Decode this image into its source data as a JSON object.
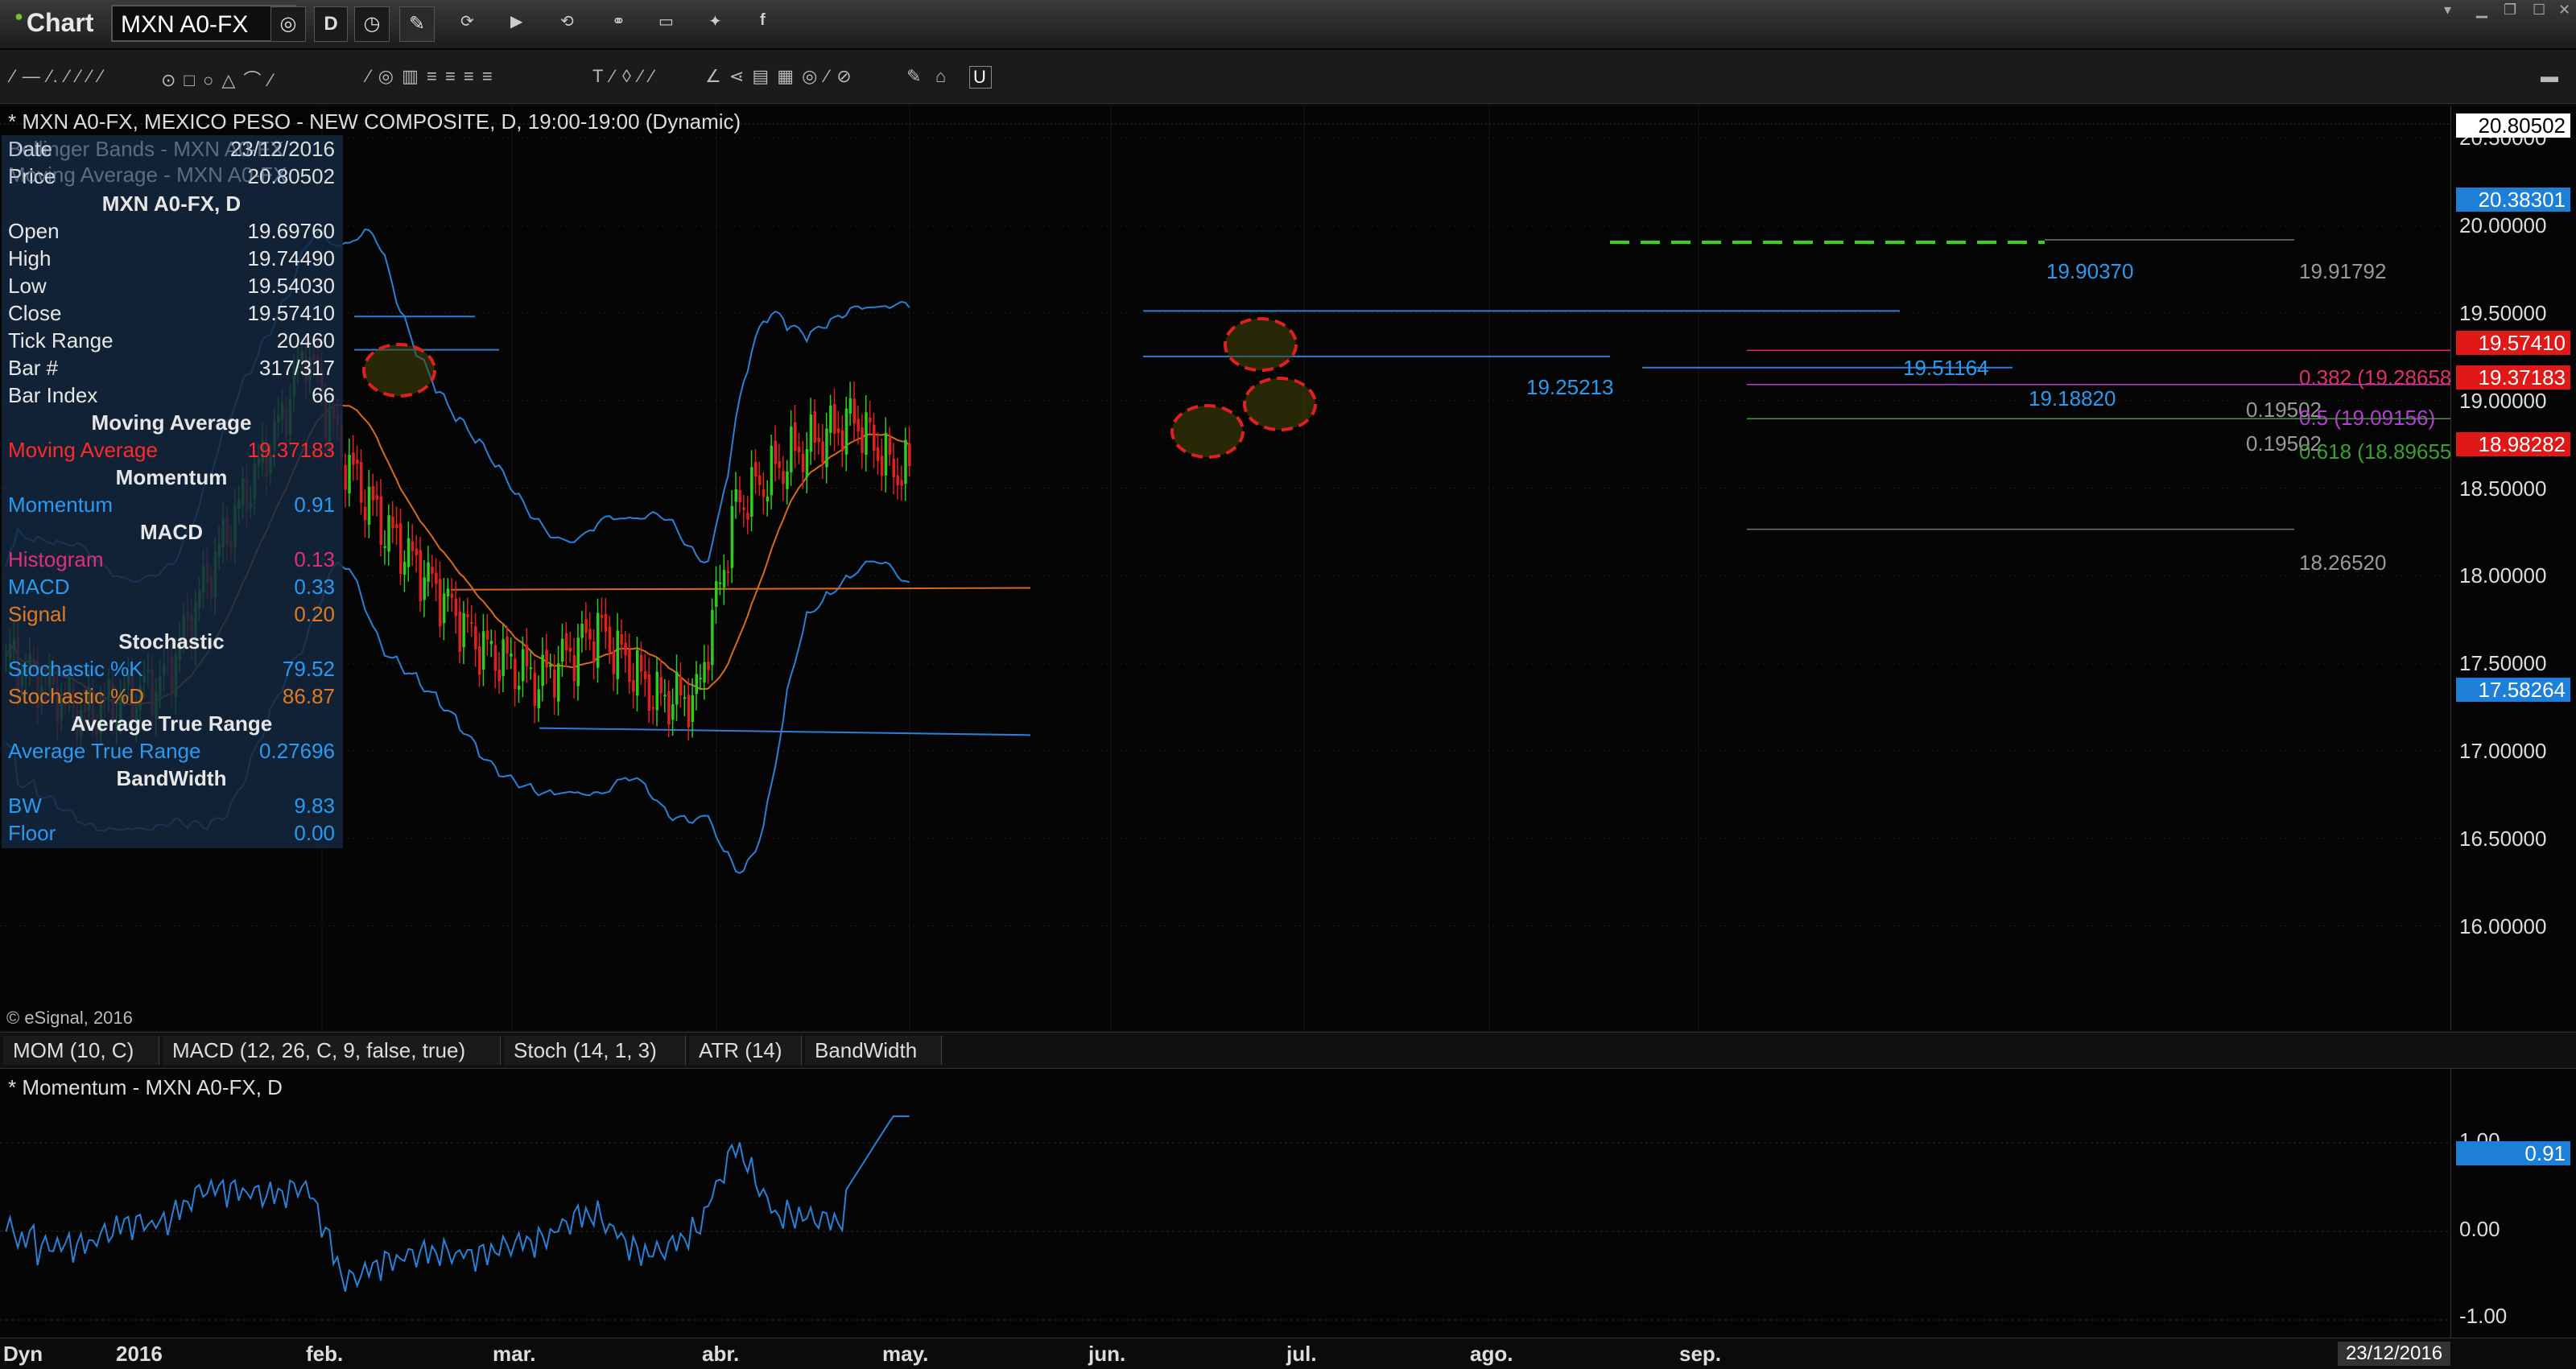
{
  "app": {
    "title": "Chart",
    "symbol": "MXN A0-FX",
    "interval": "D"
  },
  "chart": {
    "title": "* MXN A0-FX, MEXICO PESO - NEW COMPOSITE, D, 19:00-19:00 (Dynamic)",
    "legend_bb": "Bollinger Bands - MXN A0-FX",
    "legend_ma": "Moving Average - MXN A0-FX",
    "copyright": "© eSignal, 2016"
  },
  "info_panel": {
    "date_k": "Date",
    "date_v": "23/12/2016",
    "price_k": "Price",
    "price_v": "20.80502",
    "section": "MXN A0-FX, D",
    "open_k": "Open",
    "open_v": "19.69760",
    "high_k": "High",
    "high_v": "19.74490",
    "low_k": "Low",
    "low_v": "19.54030",
    "close_k": "Close",
    "close_v": "19.57410",
    "tick_k": "Tick Range",
    "tick_v": "20460",
    "bar_k": "Bar #",
    "bar_v": "317/317",
    "bar_index_k": "Bar Index",
    "bar_index_v": "66",
    "ma_hdr": "Moving Average",
    "ma_k": "Moving Average",
    "ma_v": "19.37183",
    "mom_hdr": "Momentum",
    "mom_k": "Momentum",
    "mom_v": "0.91",
    "macd_hdr": "MACD",
    "hist_k": "Histogram",
    "hist_v": "0.13",
    "macd_k": "MACD",
    "macd_v": "0.33",
    "signal_k": "Signal",
    "signal_v": "0.20",
    "stoch_hdr": "Stochastic",
    "stk_k": "Stochastic %K",
    "stk_v": "79.52",
    "std_k": "Stochastic %D",
    "std_v": "86.87",
    "atr_hdr": "Average True Range",
    "atr_k": "Average True Range",
    "atr_v": "0.27696",
    "bw_hdr": "BandWidth",
    "bw_k": "BW",
    "bw_v": "9.83",
    "floor_k": "Floor",
    "floor_v": "0.00"
  },
  "price_axis": {
    "ticks": [
      "20.50000",
      "20.00000",
      "19.50000",
      "19.00000",
      "18.50000",
      "18.00000",
      "17.50000",
      "17.00000",
      "16.50000",
      "16.00000"
    ],
    "labels": {
      "top": "20.80502",
      "bb_upper": "20.38301",
      "last": "19.57410",
      "ma": "19.37183",
      "fib": "18.98282",
      "bb_lower": "17.58264"
    }
  },
  "annotations": {
    "resistance": "19.90370",
    "hi_level": "19.91792",
    "line1": "19.51164",
    "line2": "19.25213",
    "line3": "19.18820",
    "fib382": "0.382 (19.28658)",
    "fib_a": "0.19502",
    "fib5": "0.5 (19.09156)",
    "fib_b": "0.19502",
    "fib618": "0.618 (18.89655)",
    "low_level": "18.26520"
  },
  "indicator_tabs": [
    "MOM (10, C)",
    "MACD (12, 26, C, 9, false, true)",
    "Stoch (14, 1, 3)",
    "ATR (14)",
    "BandWidth"
  ],
  "momentum": {
    "title": "* Momentum - MXN A0-FX, D",
    "ticks": [
      "1.00",
      "0.00",
      "-1.00"
    ],
    "current": "0.91"
  },
  "date_axis": {
    "dyn": "Dyn",
    "months": [
      "2016",
      "feb.",
      "mar.",
      "abr.",
      "may.",
      "jun.",
      "jul.",
      "ago.",
      "sep."
    ],
    "cursor_date": "23/12/2016"
  },
  "chart_data": {
    "type": "candlestick",
    "symbol": "MXN A0-FX",
    "last": {
      "open": 19.6976,
      "high": 19.7449,
      "low": 19.5403,
      "close": 19.5741
    },
    "series": [
      {
        "name": "Bollinger Bands - MXN A0-FX",
        "bb_upper_last": 20.38301,
        "bb_lower_last": 17.58264
      },
      {
        "name": "Moving Average - MXN A0-FX",
        "last": 19.37183
      },
      {
        "name": "Momentum",
        "last": 0.91
      }
    ],
    "ylim": [
      15.9,
      20.8
    ],
    "momentum_ylim": [
      -1.1,
      1.35
    ]
  },
  "colors": {
    "up": "#2ecc1f",
    "down": "#e02020",
    "bb": "#2a7fd6",
    "ma": "#d96a1a",
    "fib382": "#e0306a",
    "fib5": "#b040d0",
    "fib618": "#3aa030",
    "annot": "#2a9af0",
    "dashed": "#38d418"
  }
}
